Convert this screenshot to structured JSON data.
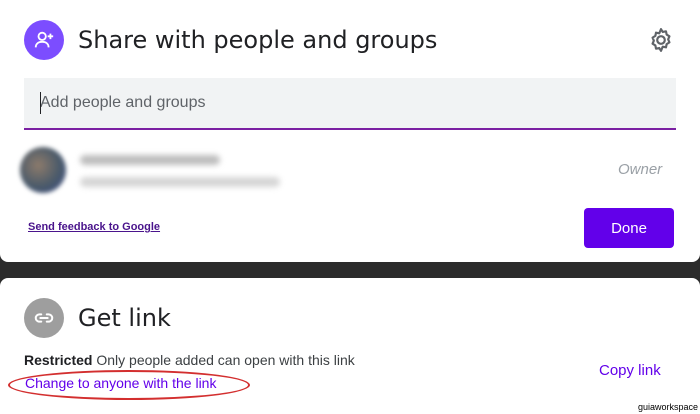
{
  "share": {
    "title": "Share with people and groups",
    "input_placeholder": "Add people and groups",
    "owner_label": "Owner",
    "feedback_link": "Send feedback to Google",
    "done_label": "Done"
  },
  "get_link": {
    "title": "Get link",
    "access_level": "Restricted",
    "access_description": "Only people added can open with this link",
    "change_link": "Change to anyone with the link",
    "copy_link": "Copy link"
  },
  "watermark": "guiaworkspace",
  "colors": {
    "accent": "#6200ea",
    "share_avatar": "#7c4dff",
    "link_avatar": "#9e9e9e",
    "annotation": "#d32f2f"
  },
  "icons": {
    "share_avatar": "person-add-icon",
    "settings": "gear-icon",
    "link": "link-icon"
  }
}
